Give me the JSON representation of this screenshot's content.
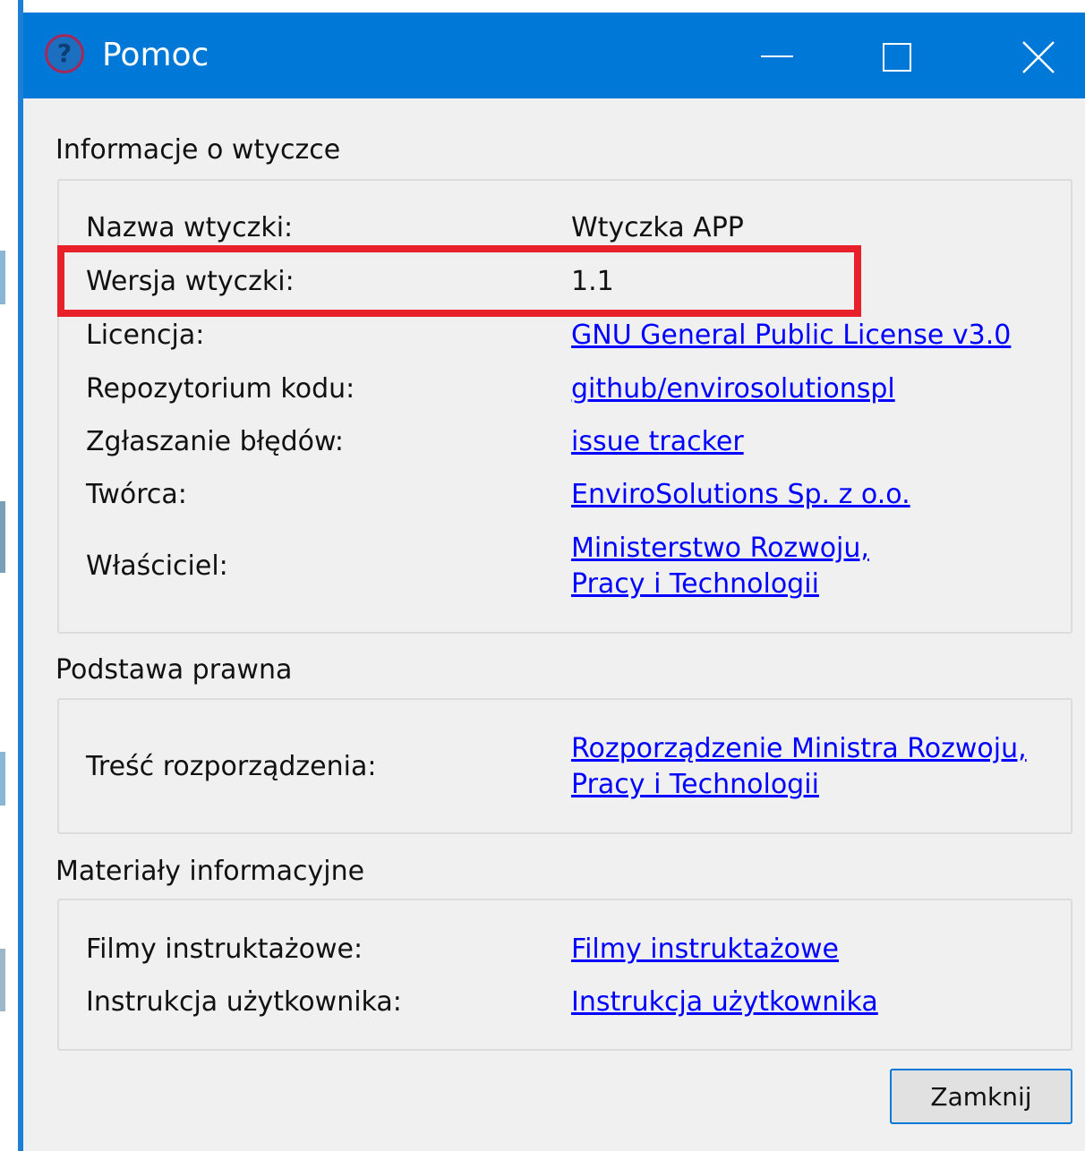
{
  "window": {
    "title": "Pomoc",
    "icon": "help-question-icon",
    "accent_color": "#0078d7",
    "controls": [
      "minimize-icon",
      "maximize-icon",
      "close-icon"
    ]
  },
  "plugin_info": {
    "section_title": "Informacje o wtyczce",
    "rows": [
      {
        "label": "Nazwa wtyczki:",
        "value": "Wtyczka APP"
      },
      {
        "label": "Wersja wtyczki:",
        "value": "1.1"
      },
      {
        "label": "Licencja:",
        "link": "GNU General Public License v3.0"
      },
      {
        "label": "Repozytorium kodu:",
        "link": "github/envirosolutionspl"
      },
      {
        "label": "Zgłaszanie błędów:",
        "link": "issue tracker"
      },
      {
        "label": "Twórca:",
        "link": "EnviroSolutions Sp. z o.o."
      },
      {
        "label": "Właściciel:",
        "link_lines": [
          "Ministerstwo Rozwoju,",
          "Pracy i Technologii"
        ]
      }
    ]
  },
  "legal_basis": {
    "section_title": "Podstawa prawna",
    "rows": [
      {
        "label": "Treść rozporządzenia:",
        "link_lines": [
          "Rozporządzenie Ministra Rozwoju,",
          "Pracy i Technologii"
        ]
      }
    ]
  },
  "info_materials": {
    "section_title": "Materiały informacyjne",
    "rows": [
      {
        "label": "Filmy instruktażowe:",
        "link": "Filmy instruktażowe"
      },
      {
        "label": "Instrukcja użytkownika:",
        "link": "Instrukcja użytkownika"
      }
    ]
  },
  "highlight_color": "#e8202a",
  "close_button": {
    "label": "Zamknij"
  }
}
